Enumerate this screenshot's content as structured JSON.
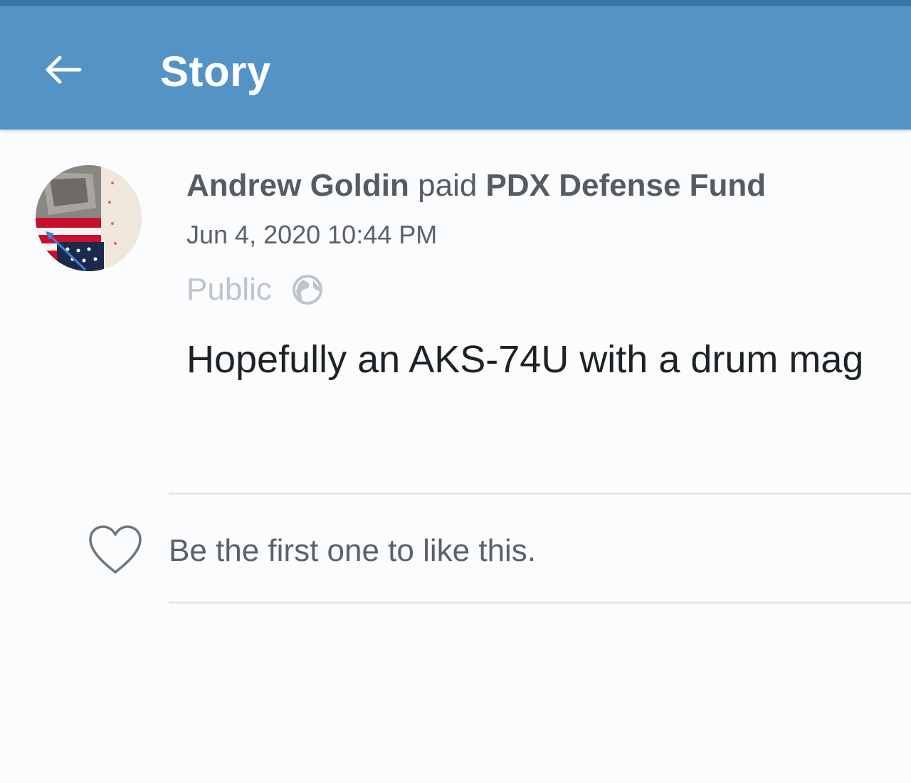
{
  "app_bar": {
    "title": "Story",
    "back_icon": "arrow-left-icon",
    "background_color": "#5393c6"
  },
  "story": {
    "actor_name": "Andrew Goldin",
    "verb": "paid",
    "target_name": "PDX Defense Fund",
    "timestamp": "Jun 4, 2020 10:44 PM",
    "privacy_label": "Public",
    "privacy_icon": "globe-icon",
    "message": "Hopefully an AKS-74U with a drum mag"
  },
  "likes": {
    "icon": "heart-outline-icon",
    "text": "Be the first one to like this."
  }
}
